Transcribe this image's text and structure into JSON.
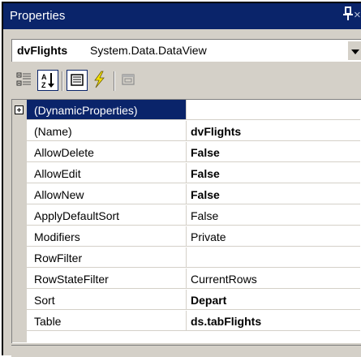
{
  "titlebar": {
    "title": "Properties",
    "pin_icon": "pin-icon",
    "close_glyph": "×"
  },
  "object_selector": {
    "name": "dvFlights",
    "type": "System.Data.DataView"
  },
  "toolbar": {
    "buttons": [
      {
        "icon": "categorized-icon",
        "pressed": false
      },
      {
        "icon": "alphabetical-sort-icon",
        "pressed": true
      },
      {
        "icon": "properties-icon",
        "pressed": true
      },
      {
        "icon": "events-lightning-icon",
        "pressed": false
      },
      {
        "icon": "property-pages-icon",
        "pressed": false
      }
    ]
  },
  "grid": {
    "rows": [
      {
        "name": "(DynamicProperties)",
        "value": "",
        "bold": false,
        "expandable": true,
        "selected": true
      },
      {
        "name": "(Name)",
        "value": "dvFlights",
        "bold": true
      },
      {
        "name": "AllowDelete",
        "value": "False",
        "bold": true
      },
      {
        "name": "AllowEdit",
        "value": "False",
        "bold": true
      },
      {
        "name": "AllowNew",
        "value": "False",
        "bold": true
      },
      {
        "name": "ApplyDefaultSort",
        "value": "False",
        "bold": false
      },
      {
        "name": "Modifiers",
        "value": "Private",
        "bold": false
      },
      {
        "name": "RowFilter",
        "value": "",
        "bold": false
      },
      {
        "name": "RowStateFilter",
        "value": "CurrentRows",
        "bold": false
      },
      {
        "name": "Sort",
        "value": "Depart",
        "bold": true
      },
      {
        "name": "Table",
        "value": "ds.tabFlights",
        "bold": true
      }
    ]
  },
  "colors": {
    "titlebar_bg": "#0a246a",
    "panel_bg": "#d4d0c8",
    "selection_bg": "#0a246a"
  }
}
